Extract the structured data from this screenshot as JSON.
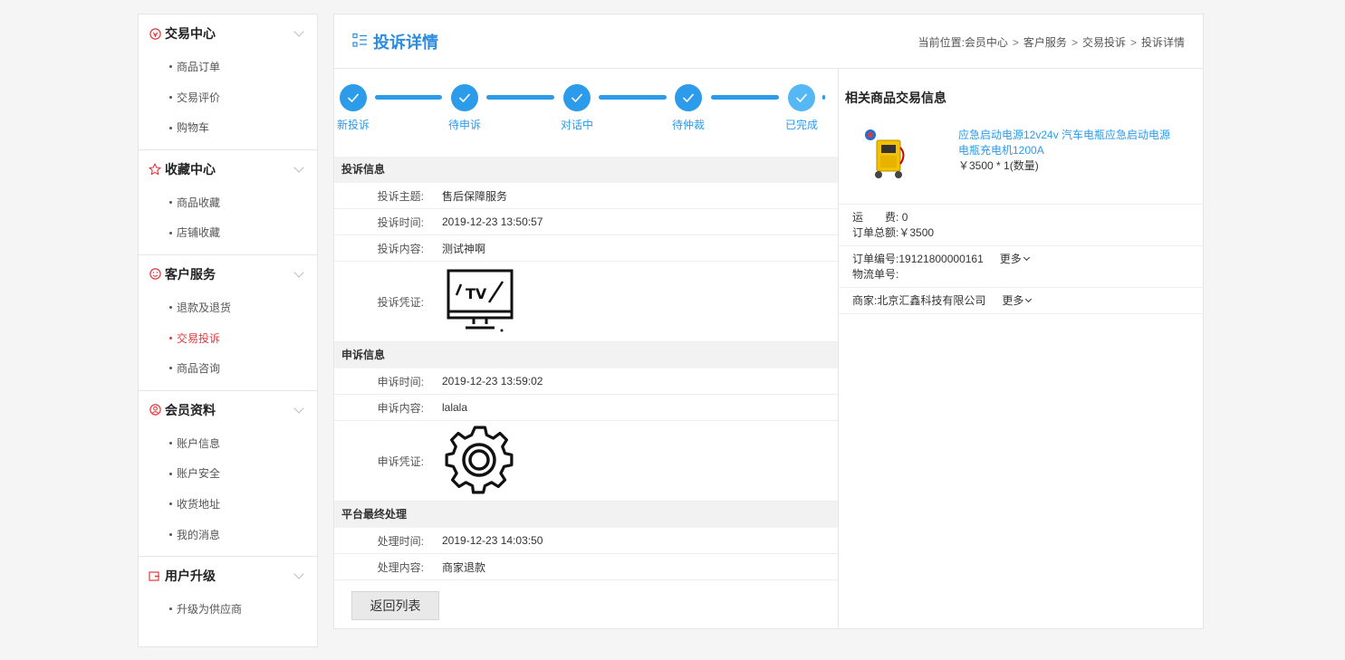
{
  "sidebar": {
    "groups": [
      {
        "title": "交易中心",
        "icon": "trade-icon",
        "items": [
          "商品订单",
          "交易评价",
          "购物车"
        ]
      },
      {
        "title": "收藏中心",
        "icon": "star-icon",
        "items": [
          "商品收藏",
          "店铺收藏"
        ]
      },
      {
        "title": "客户服务",
        "icon": "smile-icon",
        "items": [
          "退款及退货",
          "交易投诉",
          "商品咨询"
        ],
        "active": "交易投诉"
      },
      {
        "title": "会员资料",
        "icon": "user-icon",
        "items": [
          "账户信息",
          "账户安全",
          "收货地址",
          "我的消息"
        ]
      },
      {
        "title": "用户升级",
        "icon": "upgrade-icon",
        "items": [
          "升级为供应商"
        ]
      }
    ]
  },
  "header": {
    "title": "投诉详情",
    "breadcrumb": [
      "当前位置:会员中心",
      "客户服务",
      "交易投诉",
      "投诉详情"
    ],
    "sep": ">"
  },
  "steps": [
    "新投诉",
    "待申诉",
    "对话中",
    "待仲裁",
    "已完成"
  ],
  "complaint": {
    "section": "投诉信息",
    "subject_label": "投诉主题:",
    "subject": "售后保障服务",
    "time_label": "投诉时间:",
    "time": "2019-12-23 13:50:57",
    "content_label": "投诉内容:",
    "content": "测试神啊",
    "evidence_label": "投诉凭证:",
    "evidence_icon": "tv-icon"
  },
  "appeal": {
    "section": "申诉信息",
    "time_label": "申诉时间:",
    "time": "2019-12-23 13:59:02",
    "content_label": "申诉内容:",
    "content": "lalala",
    "evidence_label": "申诉凭证:",
    "evidence_icon": "gear-icon"
  },
  "final": {
    "section": "平台最终处理",
    "time_label": "处理时间:",
    "time": "2019-12-23 14:03:50",
    "content_label": "处理内容:",
    "content": "商家退款"
  },
  "back_button": "返回列表",
  "related": {
    "title": "相关商品交易信息",
    "product_name": "应急启动电源12v24v 汽车电瓶应急启动电源电瓶充电机1200A",
    "product_price": "￥3500 * 1(数量)",
    "shipping_label": "运　　费:",
    "shipping": "0",
    "total_label": "订单总额:",
    "total": "￥3500",
    "order_no_label": "订单编号:",
    "order_no": "19121800000161",
    "logistics_label": "物流单号:",
    "logistics": "",
    "more": "更多",
    "merchant_label": "商家:",
    "merchant": "北京汇鑫科技有限公司"
  },
  "colors": {
    "accent": "#2b9bea",
    "active": "#e4393c"
  }
}
